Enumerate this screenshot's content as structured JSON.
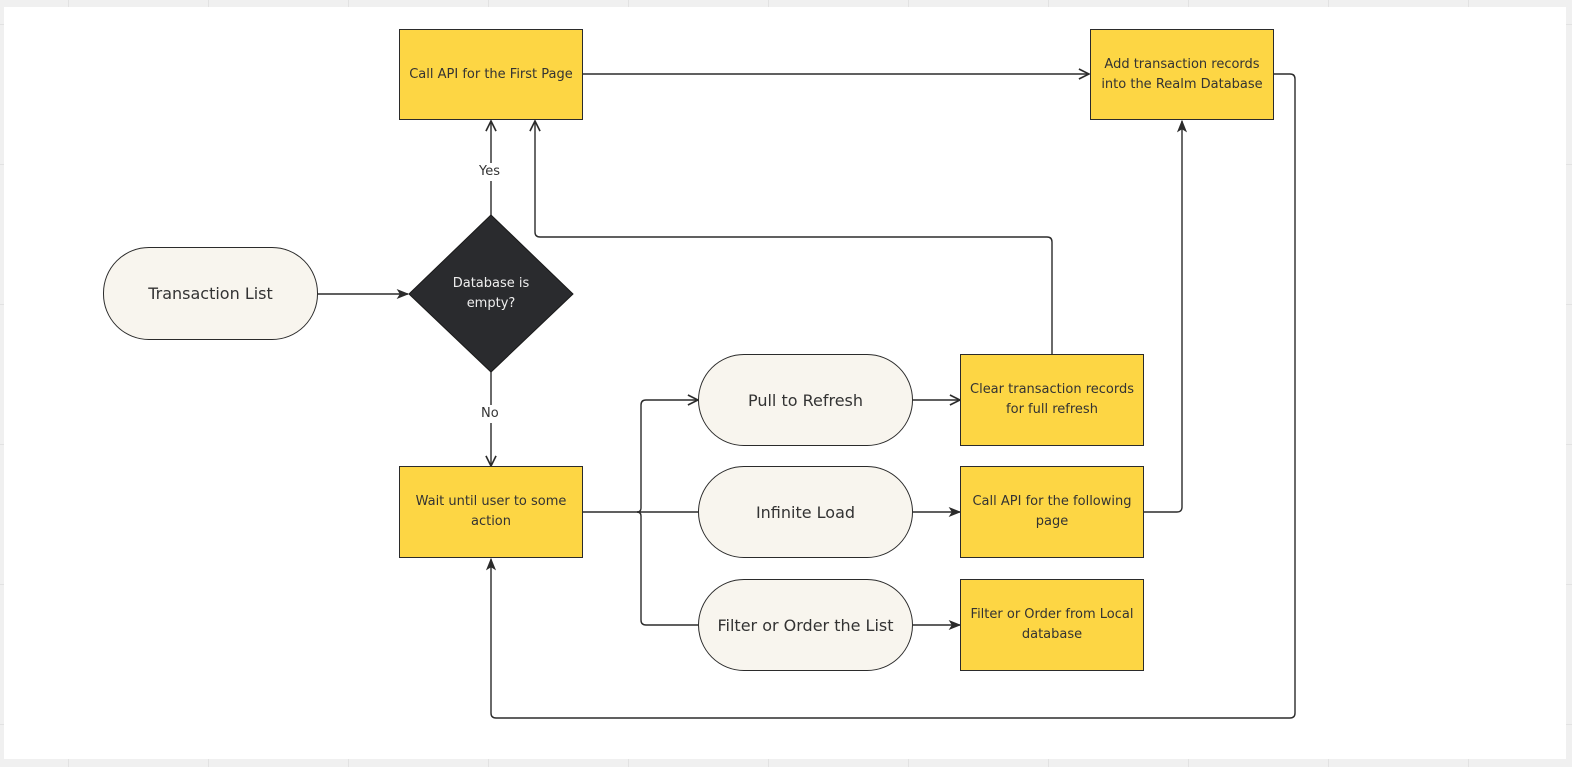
{
  "diagram": {
    "type": "flowchart",
    "colors": {
      "process_fill": "#fdd644",
      "terminal_fill": "#f8f5ee",
      "decision_fill": "#2a2b2e",
      "stroke": "#2b2b2b"
    },
    "nodes": {
      "transaction_list": {
        "label": "Transaction List",
        "shape": "terminal"
      },
      "database_empty": {
        "label": "Database is empty?",
        "shape": "decision"
      },
      "call_api_first": {
        "label": "Call API for the First Page",
        "shape": "process"
      },
      "add_records": {
        "label": "Add transaction records into the Realm Database",
        "shape": "process"
      },
      "wait_action": {
        "label": "Wait until user to some action",
        "shape": "process"
      },
      "pull_refresh": {
        "label": "Pull to Refresh",
        "shape": "terminal"
      },
      "infinite_load": {
        "label": "Infinite Load",
        "shape": "terminal"
      },
      "filter_order": {
        "label": "Filter or Order the List",
        "shape": "terminal"
      },
      "clear_records": {
        "label": "Clear transaction records for full refresh",
        "shape": "process"
      },
      "call_api_following": {
        "label": "Call API for the following page",
        "shape": "process"
      },
      "filter_local": {
        "label": "Filter or Order from Local database",
        "shape": "process"
      }
    },
    "edges": [
      {
        "from": "transaction_list",
        "to": "database_empty",
        "label": ""
      },
      {
        "from": "database_empty",
        "to": "call_api_first",
        "label": "Yes"
      },
      {
        "from": "database_empty",
        "to": "wait_action",
        "label": "No"
      },
      {
        "from": "call_api_first",
        "to": "add_records",
        "label": ""
      },
      {
        "from": "add_records",
        "to": "wait_action",
        "label": ""
      },
      {
        "from": "wait_action",
        "to": "pull_refresh",
        "label": ""
      },
      {
        "from": "wait_action",
        "to": "infinite_load",
        "label": ""
      },
      {
        "from": "wait_action",
        "to": "filter_order",
        "label": ""
      },
      {
        "from": "pull_refresh",
        "to": "clear_records",
        "label": ""
      },
      {
        "from": "infinite_load",
        "to": "call_api_following",
        "label": ""
      },
      {
        "from": "filter_order",
        "to": "filter_local",
        "label": ""
      },
      {
        "from": "clear_records",
        "to": "call_api_first",
        "label": ""
      },
      {
        "from": "call_api_following",
        "to": "add_records",
        "label": ""
      }
    ],
    "edge_labels": {
      "yes": "Yes",
      "no": "No"
    }
  }
}
